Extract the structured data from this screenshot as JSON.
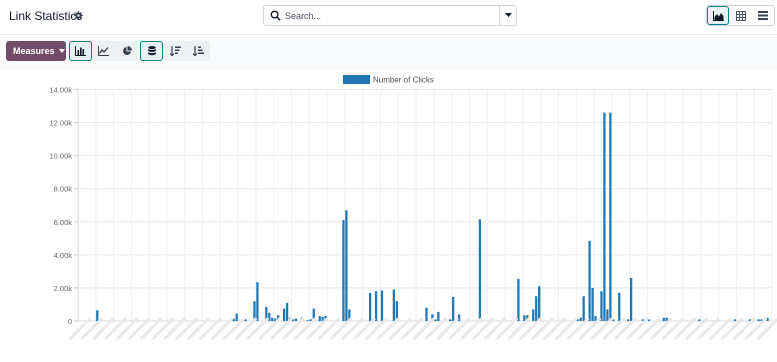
{
  "header": {
    "title": "Link Statistics",
    "settings_icon": "gear-icon"
  },
  "search": {
    "placeholder": "Search..."
  },
  "view_switcher": [
    {
      "name": "graph-view",
      "icon": "area-chart-icon",
      "active": true
    },
    {
      "name": "pivot-view",
      "icon": "pivot-table-icon",
      "active": false
    },
    {
      "name": "list-view",
      "icon": "list-icon",
      "active": false
    }
  ],
  "toolbar": {
    "measures_label": "Measures",
    "chart_types": [
      {
        "name": "bar-chart",
        "icon": "bar-chart-icon",
        "active": true
      },
      {
        "name": "line-chart",
        "icon": "line-chart-icon",
        "active": false
      },
      {
        "name": "pie-chart",
        "icon": "pie-chart-icon",
        "active": false
      }
    ],
    "stacked": {
      "icon": "database-stack-icon",
      "active": true
    },
    "sort": [
      {
        "name": "sort-descending",
        "icon": "sort-descending-icon"
      },
      {
        "name": "sort-ascending",
        "icon": "sort-ascending-icon"
      }
    ]
  },
  "colors": {
    "bar": "#1f77b4",
    "brand": "#714b67",
    "accent": "#017e84",
    "grid": "#e5e7eb"
  },
  "chart_data": {
    "type": "bar",
    "legend": [
      "Number of Clicks"
    ],
    "legend_position": "top-center",
    "grid": true,
    "ylim": [
      0,
      14000
    ],
    "y_ticks": [
      "0",
      "2.00k",
      "4.00k",
      "6.00k",
      "8.00k",
      "10.00k",
      "12.00k",
      "14.00k"
    ],
    "series": [
      {
        "name": "Number of Clicks",
        "values": [
          0,
          0,
          0,
          0,
          0,
          0,
          650,
          0,
          0,
          0,
          0,
          0,
          0,
          0,
          0,
          0,
          0,
          0,
          0,
          0,
          0,
          0,
          0,
          0,
          0,
          0,
          0,
          0,
          0,
          0,
          0,
          0,
          0,
          0,
          0,
          0,
          0,
          0,
          0,
          0,
          0,
          0,
          0,
          0,
          0,
          0,
          0,
          0,
          0,
          0,
          0,
          0,
          150,
          450,
          0,
          0,
          100,
          0,
          0,
          1200,
          2350,
          0,
          0,
          850,
          500,
          200,
          150,
          350,
          0,
          750,
          1100,
          200,
          100,
          150,
          0,
          200,
          0,
          50,
          100,
          750,
          0,
          300,
          250,
          300,
          0,
          0,
          0,
          0,
          0,
          6100,
          6700,
          700,
          0,
          0,
          0,
          0,
          0,
          0,
          1700,
          0,
          1800,
          0,
          1850,
          0,
          0,
          0,
          1900,
          1200,
          0,
          0,
          0,
          0,
          0,
          0,
          0,
          0,
          0,
          800,
          0,
          400,
          100,
          550,
          0,
          100,
          0,
          100,
          1450,
          0,
          400,
          0,
          0,
          0,
          0,
          0,
          0,
          6150,
          0,
          0,
          0,
          0,
          0,
          0,
          0,
          100,
          0,
          0,
          0,
          0,
          2550,
          0,
          350,
          350,
          0,
          700,
          1500,
          2100,
          0,
          0,
          0,
          0,
          0,
          0,
          0,
          0,
          0,
          0,
          0,
          0,
          100,
          200,
          1500,
          0,
          4850,
          2000,
          300,
          0,
          1800,
          12600,
          700,
          12600,
          100,
          0,
          1700,
          0,
          0,
          100,
          2600,
          0,
          0,
          0,
          100,
          0,
          100,
          0,
          0,
          0,
          0,
          200,
          200,
          0,
          0,
          0,
          0,
          0,
          0,
          0,
          0,
          0,
          0,
          100,
          0,
          0,
          0,
          0,
          0,
          0,
          0,
          0,
          0,
          0,
          0,
          100,
          0,
          0,
          0,
          0,
          100,
          0,
          0,
          100,
          100,
          0,
          200,
          0
        ]
      }
    ]
  }
}
